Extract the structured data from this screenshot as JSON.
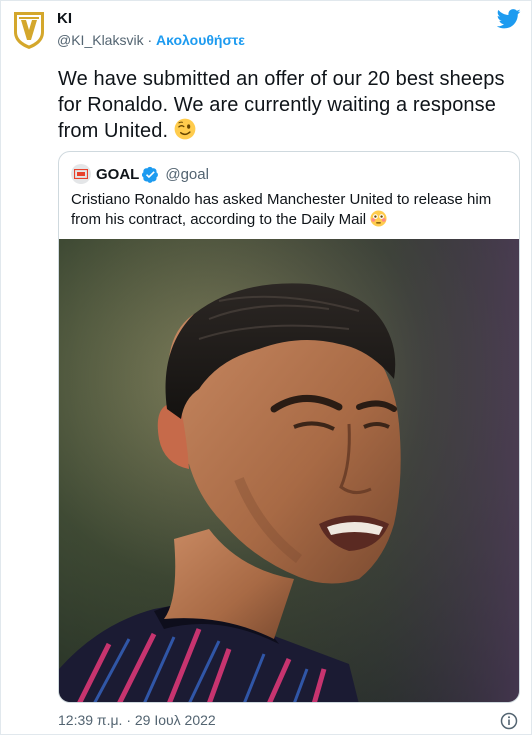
{
  "author": {
    "display_name": "ΚΙ",
    "handle": "@KI_Klaksvik",
    "separator": "·",
    "follow_label": "Ακολουθήστε",
    "avatar_icon": "klaksvik-crest-icon"
  },
  "tweet": {
    "text": "We have submitted an offer of our 20 best sheeps for Ronaldo. We are currently waiting a response from United.",
    "emoji_icon": "winking-face-emoji"
  },
  "quoted_tweet": {
    "display_name": "GOAL",
    "handle": "@goal",
    "verified_icon": "verified-badge-icon",
    "text": "Cristiano Ronaldo has asked Manchester United to release him from his contract, according to the Daily Mail",
    "emoji_icon": "flushed-face-emoji",
    "image_icon": "ronaldo-photo"
  },
  "footer": {
    "timestamp": "12:39 π.μ. · 29 Ιουλ 2022",
    "info_icon": "info-icon"
  },
  "colors": {
    "accent": "#1d9bf0",
    "text": "#0f1419",
    "muted": "#536471",
    "border": "#cfd9de",
    "crest_gold": "#d4a72c"
  }
}
